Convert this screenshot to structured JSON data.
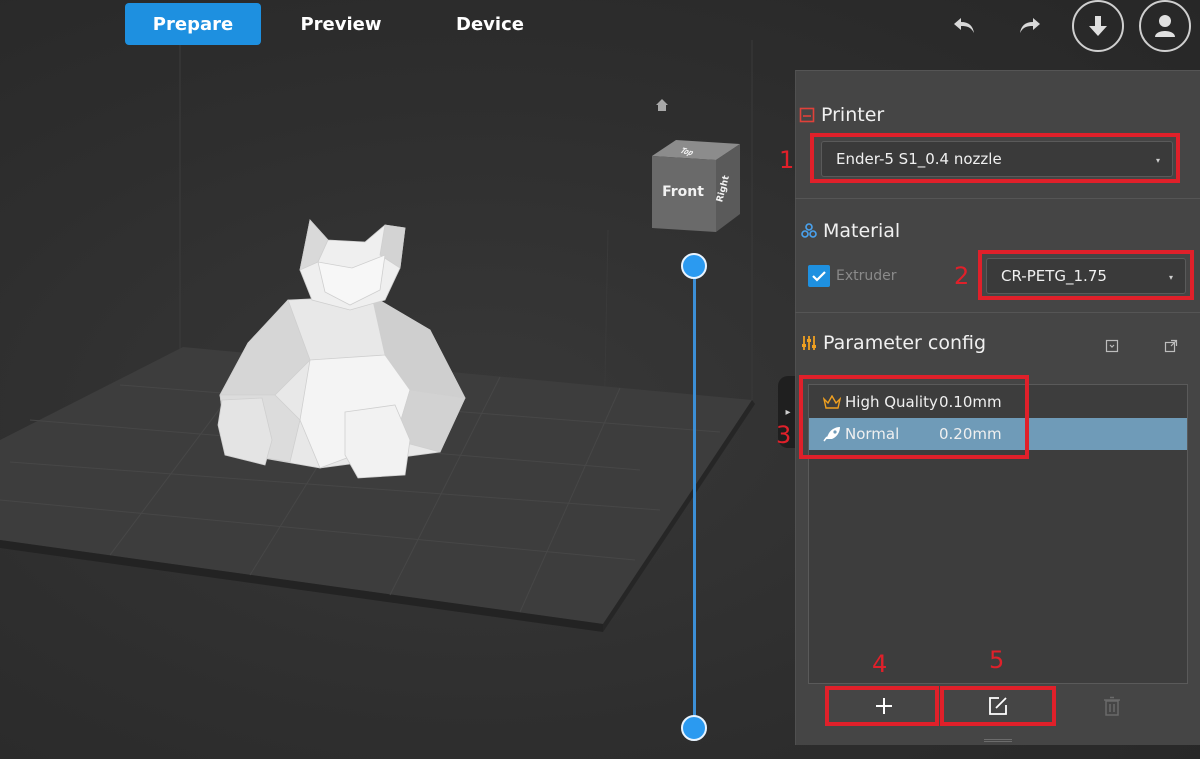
{
  "tabs": [
    {
      "label": "Prepare",
      "active": true
    },
    {
      "label": "Preview",
      "active": false
    },
    {
      "label": "Device",
      "active": false
    }
  ],
  "toolbar": {
    "undo_icon": "undo-icon",
    "redo_icon": "redo-icon",
    "download_icon": "download-icon",
    "account_icon": "user-icon"
  },
  "navcube": {
    "front": "Front",
    "top": "Top",
    "right": "Right"
  },
  "panel": {
    "printer": {
      "title": "Printer",
      "selected": "Ender-5 S1_0.4 nozzle"
    },
    "material": {
      "title": "Material",
      "extruder_label": "Extruder",
      "extruder_checked": true,
      "selected": "CR-PETG_1.75"
    },
    "parameter_config": {
      "title": "Parameter config",
      "profiles": [
        {
          "name": "High Quality",
          "layer_height": "0.10mm",
          "icon": "crown-icon",
          "selected": false
        },
        {
          "name": "Normal",
          "layer_height": "0.20mm",
          "icon": "rocket-icon",
          "selected": true
        }
      ]
    }
  },
  "annotations": [
    "1",
    "2",
    "3",
    "4",
    "5"
  ],
  "colors": {
    "accent": "#1e90e0",
    "annotation": "#e0202a",
    "selected_row": "#6f9bb8",
    "panel_bg": "#454545"
  }
}
